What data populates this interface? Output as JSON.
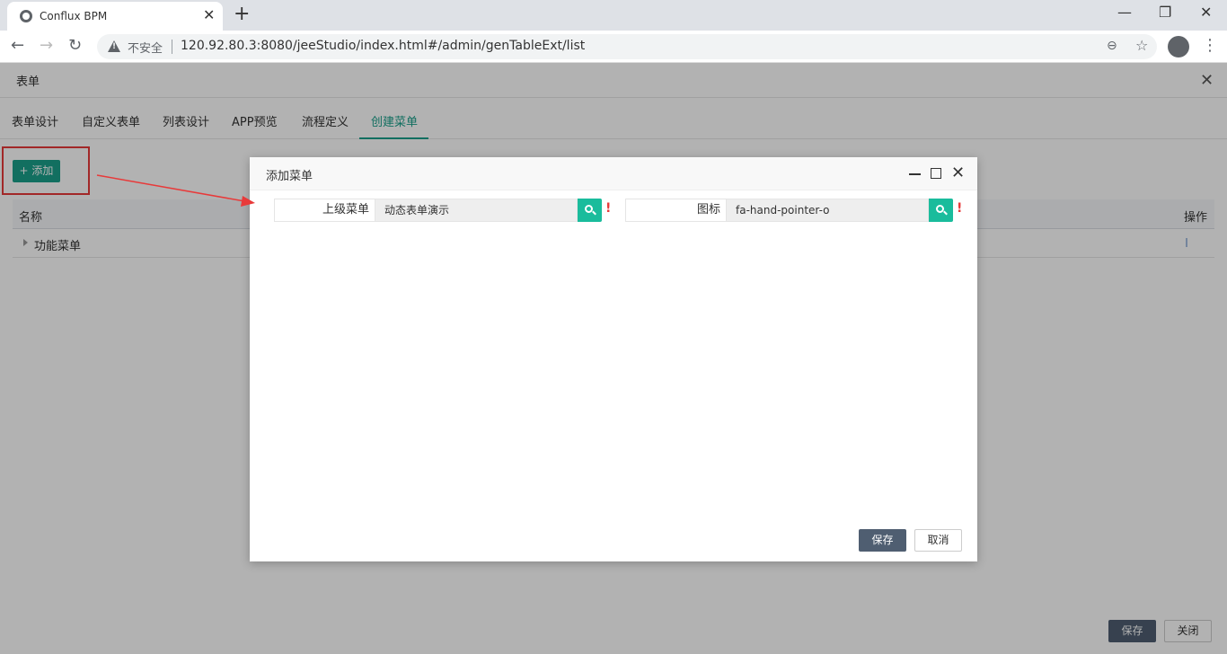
{
  "browser": {
    "tab_title": "Conflux BPM",
    "not_secure": "不安全",
    "url": "120.92.80.3:8080/jeeStudio/index.html#/admin/genTableExt/list"
  },
  "page": {
    "title": "表单",
    "tabs": [
      "表单设计",
      "自定义表单",
      "列表设计",
      "APP预览",
      "流程定义",
      "创建菜单"
    ],
    "active_tab": "创建菜单",
    "add_label": "添加",
    "table": {
      "headers": {
        "name": "名称",
        "op": "操作"
      },
      "rows": [
        {
          "name": "功能菜单"
        }
      ]
    },
    "save_label": "保存",
    "close_label": "关闭"
  },
  "dialog": {
    "title": "添加菜单",
    "parent_label": "上级菜单",
    "parent_value": "动态表单演示",
    "icon_label": "图标",
    "icon_value": "fa-hand-pointer-o",
    "required_mark": "!",
    "save_label": "保存",
    "cancel_label": "取消"
  },
  "colors": {
    "accent": "#1a9f8a",
    "search_btn": "#1abc9c",
    "primary_btn": "#4f5e71",
    "highlight": "#e83a3a"
  }
}
